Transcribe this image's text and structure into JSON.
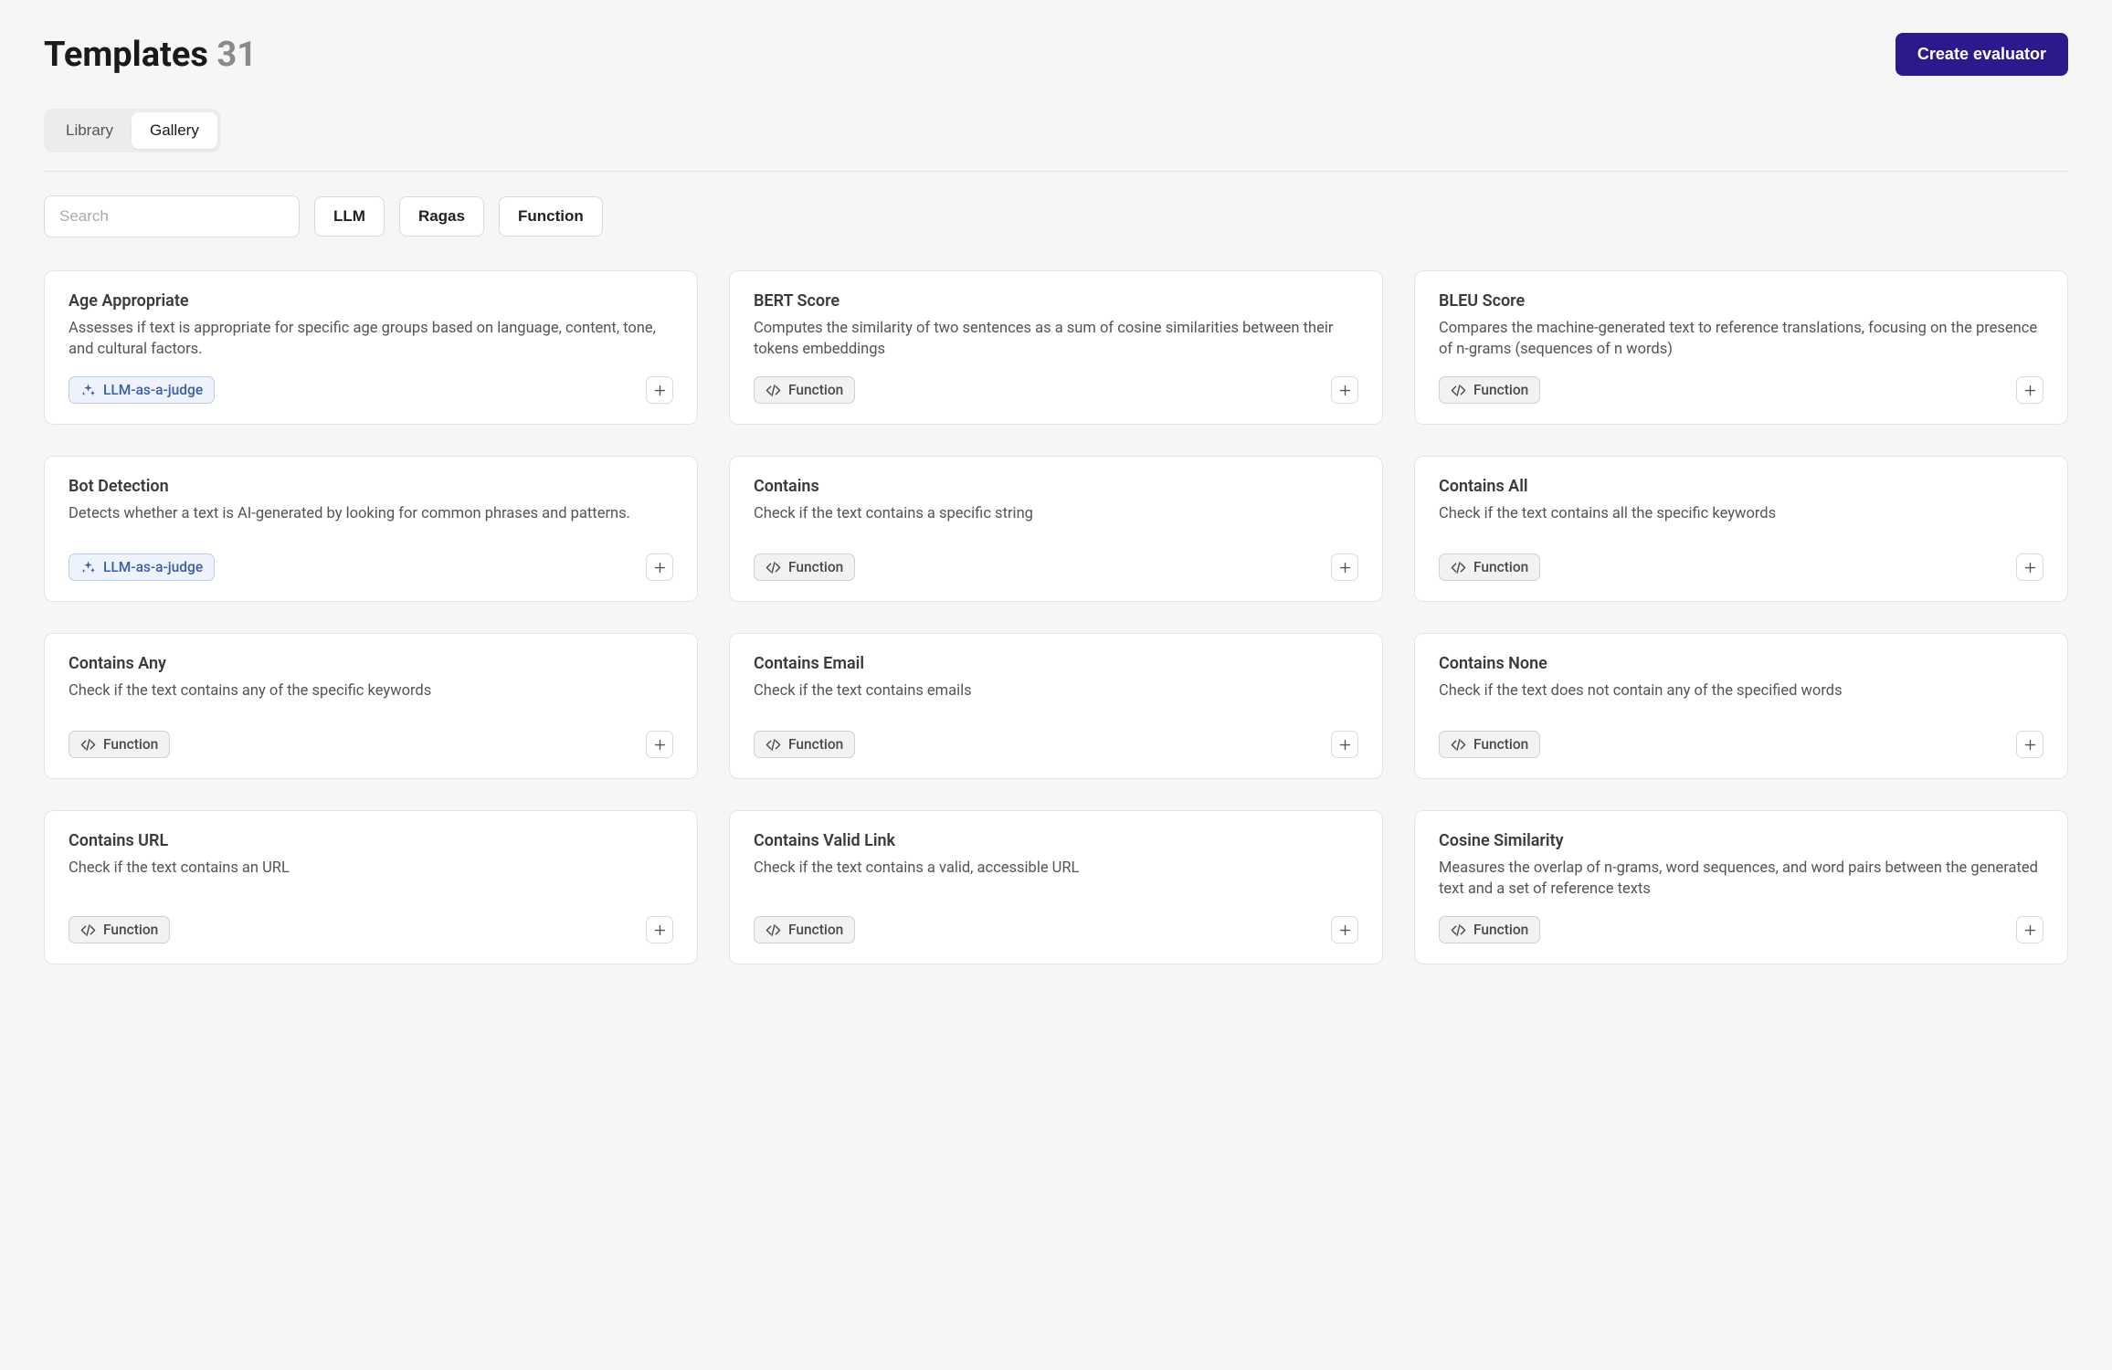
{
  "header": {
    "title": "Templates",
    "count": "31",
    "create_button": "Create evaluator"
  },
  "tabs": {
    "library": "Library",
    "gallery": "Gallery",
    "active": "gallery"
  },
  "search": {
    "placeholder": "Search"
  },
  "filters": {
    "llm": "LLM",
    "ragas": "Ragas",
    "function": "Function"
  },
  "badges": {
    "llm_judge": "LLM-as-a-judge",
    "function": "Function"
  },
  "cards": [
    {
      "title": "Age Appropriate",
      "desc": "Assesses if text is appropriate for specific age groups based on language, content, tone, and cultural factors.",
      "badge_type": "llm"
    },
    {
      "title": "BERT Score",
      "desc": "Computes the similarity of two sentences as a sum of cosine similarities between their tokens embeddings",
      "badge_type": "fn"
    },
    {
      "title": "BLEU Score",
      "desc": "Compares the machine-generated text to reference translations, focusing on the presence of n-grams (sequences of n words)",
      "badge_type": "fn"
    },
    {
      "title": "Bot Detection",
      "desc": "Detects whether a text is AI-generated by looking for common phrases and patterns.",
      "badge_type": "llm"
    },
    {
      "title": "Contains",
      "desc": "Check if the text contains a specific string",
      "badge_type": "fn"
    },
    {
      "title": "Contains All",
      "desc": "Check if the text contains all the specific keywords",
      "badge_type": "fn"
    },
    {
      "title": "Contains Any",
      "desc": "Check if the text contains any of the specific keywords",
      "badge_type": "fn"
    },
    {
      "title": "Contains Email",
      "desc": "Check if the text contains emails",
      "badge_type": "fn"
    },
    {
      "title": "Contains None",
      "desc": "Check if the text does not contain any of the specified words",
      "badge_type": "fn"
    },
    {
      "title": "Contains URL",
      "desc": "Check if the text contains an URL",
      "badge_type": "fn"
    },
    {
      "title": "Contains Valid Link",
      "desc": "Check if the text contains a valid, accessible URL",
      "badge_type": "fn"
    },
    {
      "title": "Cosine Similarity",
      "desc": "Measures the overlap of n-grams, word sequences, and word pairs between the generated text and a set of reference texts",
      "badge_type": "fn"
    }
  ]
}
